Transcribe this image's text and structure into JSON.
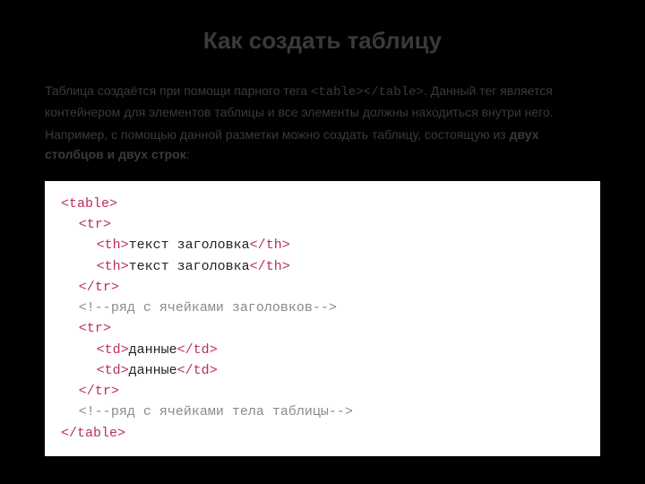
{
  "heading": "Как создать таблицу",
  "p1_a": "Таблица создаётся при помощи парного тега ",
  "p1_tag": "<table></table>",
  "p1_b": ". Данный тег является контейнером для элементов таблицы и все элементы должны находиться внутри него.",
  "p2_a": "Например, с помощью данной разметки можно создать таблицу, состоящую из ",
  "p2_strong": "двух столбцов и двух строк",
  "p2_b": ":",
  "code": {
    "lt": "<",
    "gt": ">",
    "lts": "</",
    "cmto": "<!--",
    "cmtc": "-->",
    "table": "table",
    "tr": "tr",
    "th": "th",
    "td": "td",
    "txt_th": "текст заголовка",
    "txt_td": "данные",
    "cmt1": "ряд с ячейками заголовков",
    "cmt2": "ряд с ячейками тела таблицы"
  }
}
